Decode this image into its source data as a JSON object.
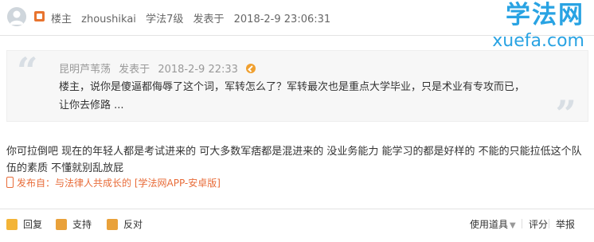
{
  "header": {
    "role": "楼主",
    "username": "zhoushikai",
    "level": "学法7级",
    "posted_prefix": "发表于",
    "posted_time": "2018-2-9 23:06:31"
  },
  "watermark": {
    "title": "学法网",
    "host": "xuefa.com"
  },
  "quote": {
    "author": "昆明芦苇荡",
    "posted_prefix": "发表于",
    "posted_time": "2018-2-9 22:33",
    "text": "楼主，说你是傻逼都侮辱了这个词，军转怎么了？军转最次也是重点大学毕业，只是术业有专攻而已，让你去修路 ..."
  },
  "post": {
    "body": "你可拉倒吧 现在的年轻人都是考试进来的 可大多数军痞都是混进来的 没业务能力 能学习的都是好样的 不能的只能拉低这个队伍的素质  不懂就别乱放屁",
    "source": "发布自：与法律人共成长的 [学法网APP-安卓版]"
  },
  "footer": {
    "reply": "回复",
    "support": "支持",
    "oppose": "反对",
    "tools": "使用道具",
    "rate": "评分",
    "report": "举报"
  },
  "colors": {
    "accent": "#29a3e3",
    "source": "#e86c39",
    "icon": "#e9a13a"
  }
}
